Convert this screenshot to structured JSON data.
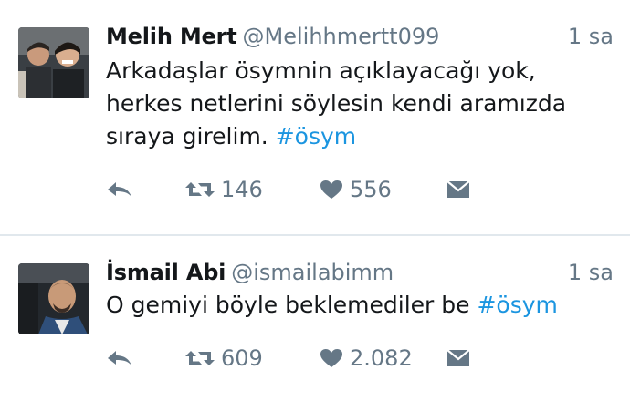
{
  "tweets": [
    {
      "name": "Melih Mert",
      "handle": "@Melihhmertt099",
      "time": "1 sa",
      "text": "Arkadaşlar ösymnin açıklayacağı yok, herkes netlerini söylesin kendi aramızda sıraya girelim.",
      "hashtag": "#ösym",
      "retweets": "146",
      "likes": "556",
      "icons": [
        "reply-icon",
        "retweet-icon",
        "heart-icon",
        "direct-message-icon"
      ]
    },
    {
      "name": "İsmail Abi",
      "handle": "@ismailabimm",
      "time": "1 sa",
      "text": "O gemiyi böyle beklemediler be",
      "hashtag": "#ösym",
      "retweets": "609",
      "likes": "2.082",
      "icons": [
        "reply-icon",
        "retweet-icon",
        "heart-icon",
        "direct-message-icon"
      ]
    }
  ],
  "colors": {
    "text": "#14171a",
    "secondary": "#657786",
    "link": "#1b95e0",
    "divider": "#e1e8ed"
  }
}
